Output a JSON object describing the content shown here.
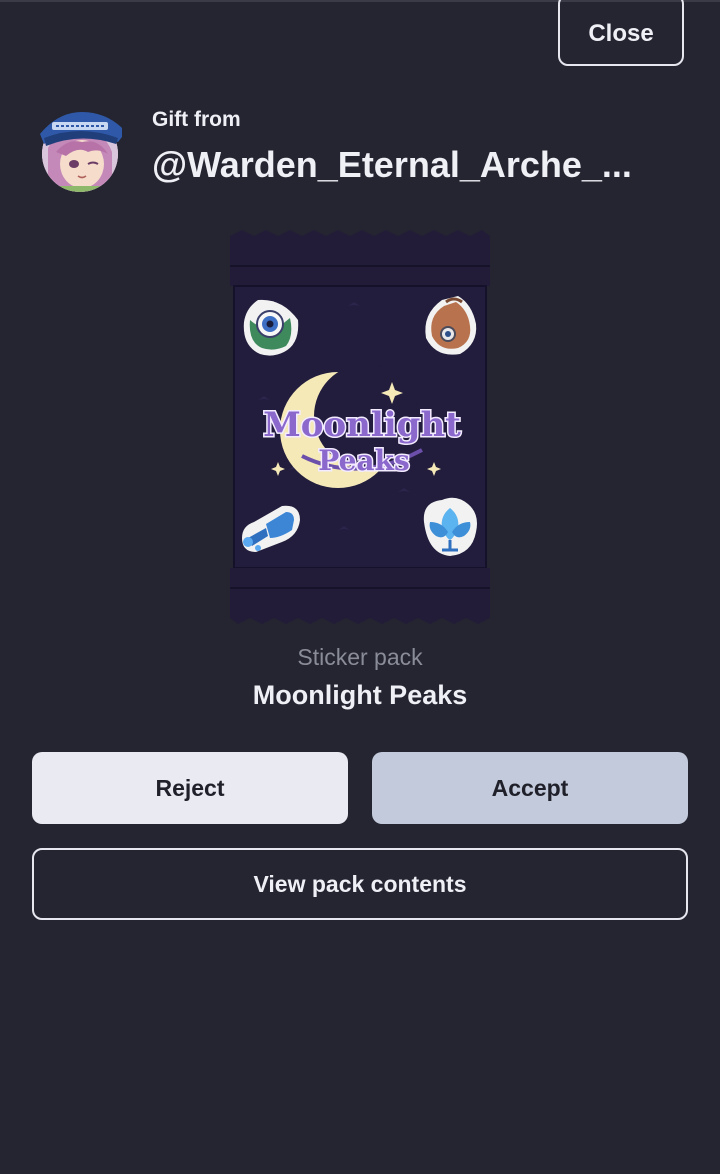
{
  "header": {
    "close_label": "Close"
  },
  "gift": {
    "from_label": "Gift from",
    "sender": "@Warden_Eternal_Arche_..."
  },
  "pack": {
    "type_label": "Sticker pack",
    "name": "Moonlight Peaks",
    "logo_line1": "Moonlight",
    "logo_line2": "Peaks",
    "icons": [
      "eyeball-sticker-icon",
      "sack-sticker-icon",
      "watering-can-sticker-icon",
      "blue-flower-sticker-icon"
    ]
  },
  "actions": {
    "reject_label": "Reject",
    "accept_label": "Accept",
    "view_label": "View pack contents"
  },
  "colors": {
    "background": "#242530",
    "pack_background": "#231d3d",
    "accept_button": "#c3cadb",
    "reject_button": "#e9eaf2",
    "logo_purple": "#7a5bbf",
    "moon_yellow": "#f5e9b8"
  }
}
